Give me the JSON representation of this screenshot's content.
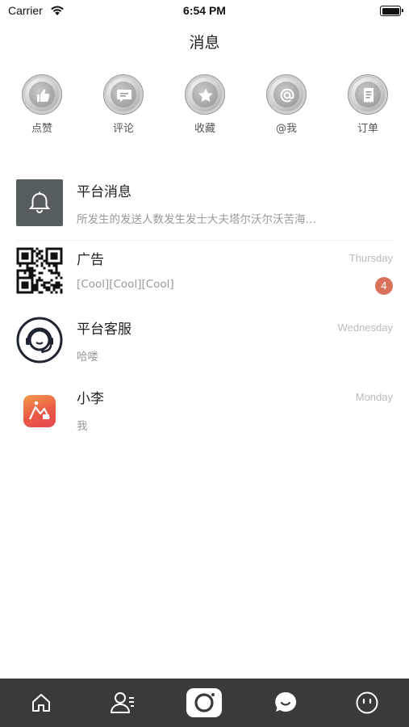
{
  "status_bar": {
    "carrier": "Carrier",
    "time": "6:54 PM",
    "wifi_icon": "wifi-icon",
    "battery_icon": "battery-icon"
  },
  "nav": {
    "title": "消息"
  },
  "quick_actions": [
    {
      "label": "点赞",
      "icon": "thumbs-up-icon"
    },
    {
      "label": "评论",
      "icon": "comment-icon"
    },
    {
      "label": "收藏",
      "icon": "star-icon"
    },
    {
      "label": "@我",
      "icon": "at-icon"
    },
    {
      "label": "订单",
      "icon": "order-icon"
    }
  ],
  "messages": [
    {
      "name": "平台消息",
      "preview": "所发生的发送人数发生发士大夫塔尔沃尔沃苦海…",
      "time": "",
      "badge": "",
      "avatar": "bell-icon"
    },
    {
      "name": "广告",
      "preview": "[Cool][Cool][Cool]",
      "time": "Thursday",
      "badge": "4",
      "avatar": "qr-code-icon"
    },
    {
      "name": "平台客服",
      "preview": "哈喽",
      "time": "Wednesday",
      "badge": "",
      "avatar": "headset-icon"
    },
    {
      "name": "小李",
      "preview": "我",
      "time": "Monday",
      "badge": "",
      "avatar": "app-icon"
    }
  ],
  "tab_bar": {
    "tabs": [
      {
        "icon": "home-icon"
      },
      {
        "icon": "contacts-icon"
      },
      {
        "icon": "camera-icon"
      },
      {
        "icon": "chat-icon"
      },
      {
        "icon": "profile-icon"
      }
    ],
    "active_tab": "chat-icon"
  },
  "colors": {
    "badge": "#d9715c",
    "tab_bar_bg": "#3a3a3a",
    "platform_avatar_bg": "#565d5e"
  }
}
